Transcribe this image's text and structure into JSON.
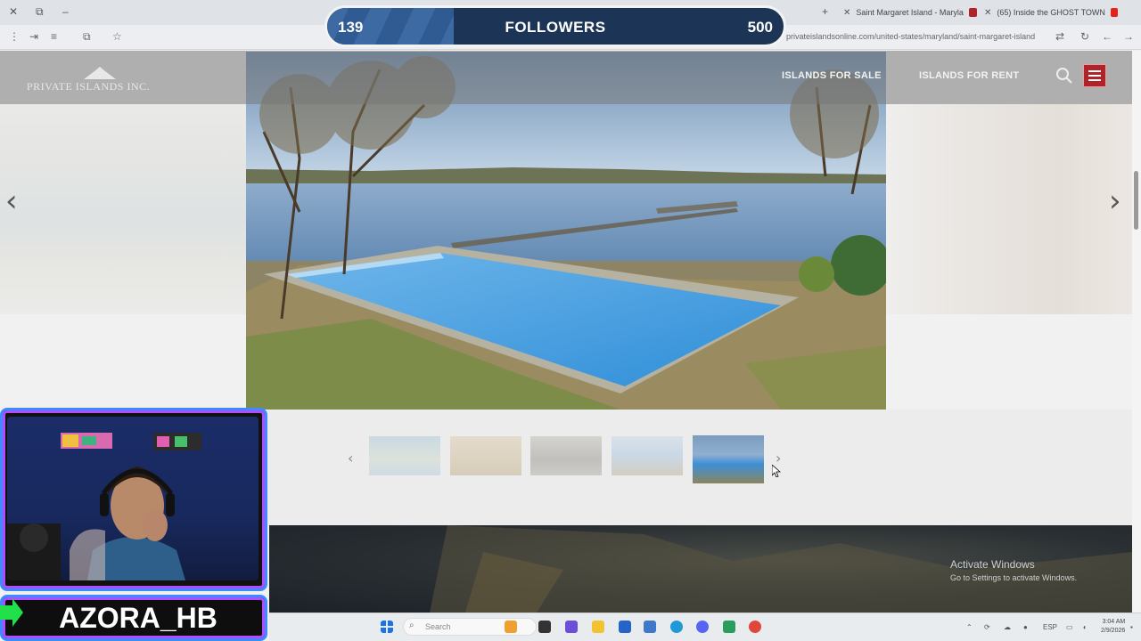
{
  "browser": {
    "tabs": [
      {
        "label": "Saint Margaret Island - Maryla",
        "favicon_color": "#b1232b"
      },
      {
        "label": "(65) Inside the GHOST TOWN",
        "favicon_color": "#e62117"
      }
    ],
    "url": "privateislandsonline.com/united-states/maryland/saint-margaret-island"
  },
  "site": {
    "logo_text": "PRIVATE ISLANDS INC.",
    "nav": {
      "islands_for_sale": "ISLANDS FOR SALE",
      "islands_for_rent": "ISLANDS FOR RENT"
    },
    "brand_color": "#b1232b"
  },
  "gallery": {
    "thumbnail_count": 5,
    "active_index": 4
  },
  "activation": {
    "title": "Activate Windows",
    "subtitle": "Go to Settings to activate Windows."
  },
  "taskbar": {
    "search_placeholder": "Search",
    "lang": "ESP",
    "time": "3:04 AM",
    "date": "2/9/2026"
  },
  "overlay": {
    "followers": {
      "current": "139",
      "label": "FOLLOWERS",
      "goal": "500",
      "progress": 0.278
    },
    "streamer_name": "AZORA_HB"
  }
}
